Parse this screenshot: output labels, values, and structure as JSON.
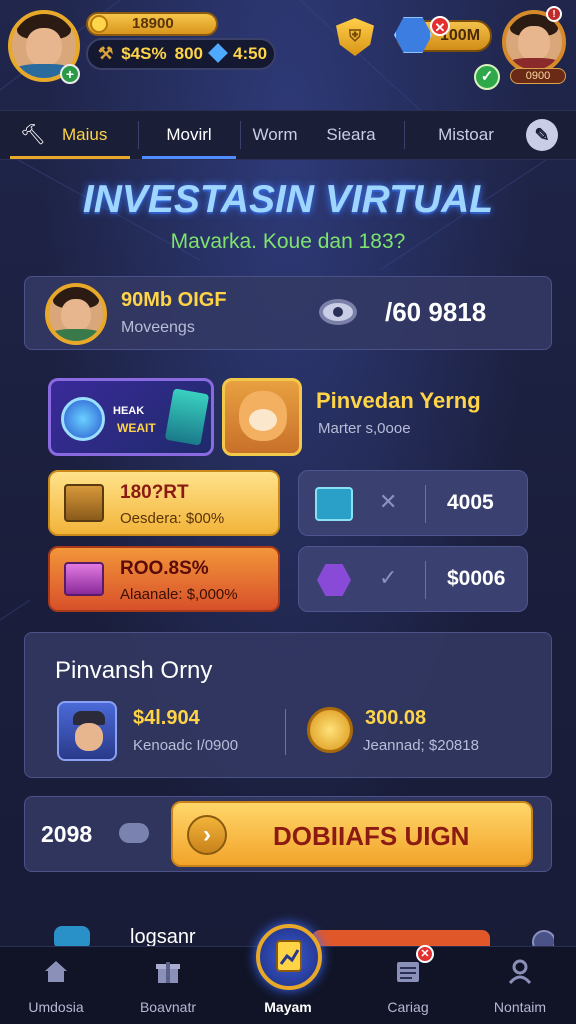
{
  "topbar": {
    "coins": "18900",
    "stat_money": "$4S%",
    "stat_count": "800",
    "stat_gems": "4:50",
    "right_pill_value": "100M",
    "right_badge": "0900"
  },
  "tabs": [
    {
      "label": "Maius"
    },
    {
      "label": "Movirl"
    },
    {
      "label": "Worm"
    },
    {
      "label": "Sieara"
    },
    {
      "label": "Mistoar"
    }
  ],
  "headline": "INVESTASIN VIRTUAL",
  "subheadline": "Mavarka. Koue dan 183?",
  "profile_card": {
    "name": "90Mb OIGF",
    "subtitle": "Moveengs",
    "value": "/60 9818"
  },
  "featured": {
    "tile_label_line1": "HEAK",
    "tile_label_line2": "WEAIT",
    "title": "Pinvedan Yerng",
    "subtitle": "Marter s,0ooe"
  },
  "offers": [
    {
      "title": "180?RT",
      "subtitle": "Oesdera: $00%"
    },
    {
      "title": "ROO.8S%",
      "subtitle": "Alaanale: $,000%"
    }
  ],
  "side_values": [
    {
      "value": "4005"
    },
    {
      "value": "$0006"
    }
  ],
  "investment": {
    "title": "Pinvansh Orny",
    "item1_value": "$4l.904",
    "item1_sub": "Kenoadc I/0900",
    "item2_value": "300.08",
    "item2_sub": "Jeannad; $20818"
  },
  "action": {
    "amount": "2098",
    "button_label": "DOBIIAFS UIGN"
  },
  "partial_row": {
    "label": "logsanr"
  },
  "bottom_nav": [
    {
      "label": "Umdosia",
      "icon": "home-icon"
    },
    {
      "label": "Boavnatr",
      "icon": "gift-icon"
    },
    {
      "label": "Mayam",
      "icon": "invest-icon"
    },
    {
      "label": "Cariag",
      "icon": "list-icon"
    },
    {
      "label": "Nontaim",
      "icon": "profile-icon"
    }
  ],
  "colors": {
    "background": "#1d2140",
    "gold": "#ffd447",
    "panel": "#343a64",
    "accent_blue": "#3b7de0",
    "headline_glow": "#3f7cff"
  }
}
